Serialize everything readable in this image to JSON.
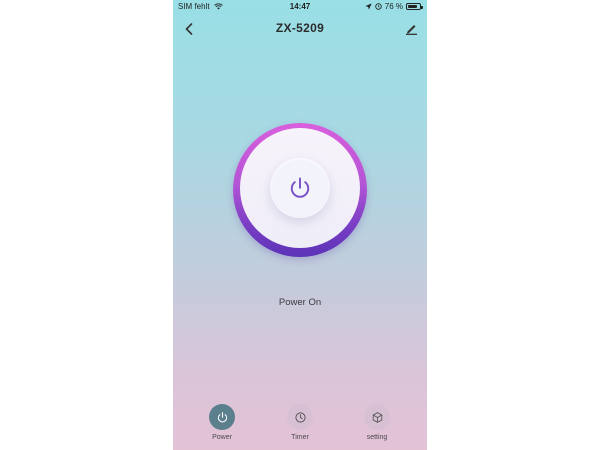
{
  "status_bar": {
    "carrier": "SIM fehlt",
    "time": "14:47",
    "battery_percent": "76 %"
  },
  "header": {
    "title": "ZX-5209"
  },
  "power": {
    "status_text": "Power On"
  },
  "tabs": [
    {
      "label": "Power",
      "icon": "power-icon",
      "active": true
    },
    {
      "label": "Timer",
      "icon": "timer-icon",
      "active": false
    },
    {
      "label": "setting",
      "icon": "cube-icon",
      "active": false
    }
  ],
  "colors": {
    "ring_top": "#d95fdc",
    "ring_bottom": "#5b33b8",
    "power_icon": "#7a52c8",
    "active_tab": "#5c7f8e"
  }
}
